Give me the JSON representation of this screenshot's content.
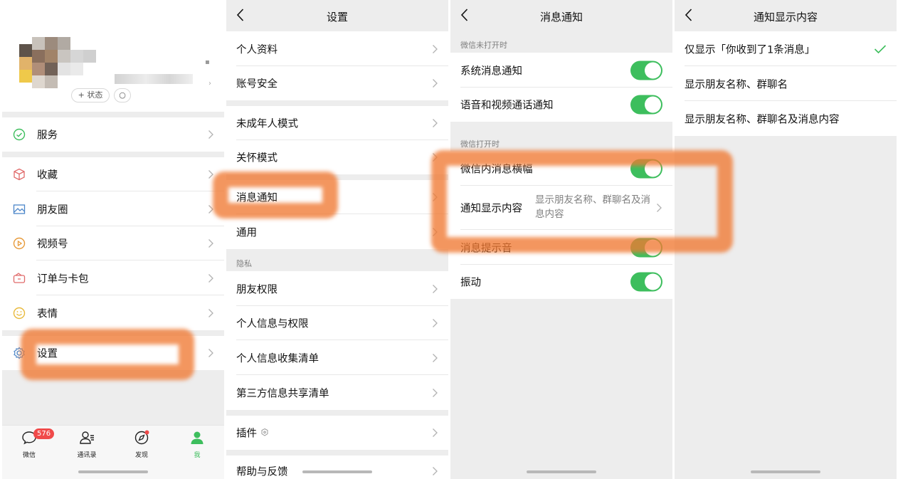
{
  "panel_me": {
    "status_label": "+ 状态",
    "menu": [
      {
        "label": "服务"
      },
      {
        "label": "收藏"
      },
      {
        "label": "朋友圈"
      },
      {
        "label": "视频号"
      },
      {
        "label": "订单与卡包"
      },
      {
        "label": "表情"
      },
      {
        "label": "设置"
      }
    ],
    "tabs": [
      {
        "label": "微信",
        "badge": "576"
      },
      {
        "label": "通讯录"
      },
      {
        "label": "发现"
      },
      {
        "label": "我"
      }
    ]
  },
  "panel_settings": {
    "title": "设置",
    "items": [
      {
        "label": "个人资料"
      },
      {
        "label": "账号安全"
      },
      {
        "label": "未成年人模式"
      },
      {
        "label": "关怀模式"
      },
      {
        "label": "消息通知"
      },
      {
        "label": "通用"
      },
      {
        "label": "朋友权限"
      },
      {
        "label": "个人信息与权限"
      },
      {
        "label": "个人信息收集清单"
      },
      {
        "label": "第三方信息共享清单"
      },
      {
        "label": "插件"
      },
      {
        "label": "帮助与反馈"
      }
    ],
    "section_privacy": "隐私"
  },
  "panel_notify": {
    "title": "消息通知",
    "section_closed": "微信未打开时",
    "section_open": "微信打开时",
    "items": [
      {
        "label": "系统消息通知",
        "enabled": true
      },
      {
        "label": "语音和视频通话通知",
        "enabled": true
      },
      {
        "label": "微信内消息横幅",
        "enabled": true
      },
      {
        "label": "通知显示内容",
        "value": "显示朋友名称、群聊名及消息内容"
      },
      {
        "label": "消息提示音",
        "enabled": true
      },
      {
        "label": "振动",
        "enabled": true
      }
    ]
  },
  "panel_content": {
    "title": "通知显示内容",
    "options": [
      {
        "label": "仅显示「你收到了1条消息」",
        "selected": true
      },
      {
        "label": "显示朋友名称、群聊名",
        "selected": false
      },
      {
        "label": "显示朋友名称、群聊名及消息内容",
        "selected": false
      }
    ]
  },
  "colors": {
    "accent_green": "#3dbe5d",
    "highlight_orange": "#f07832",
    "badge_red": "#f04a4a"
  }
}
